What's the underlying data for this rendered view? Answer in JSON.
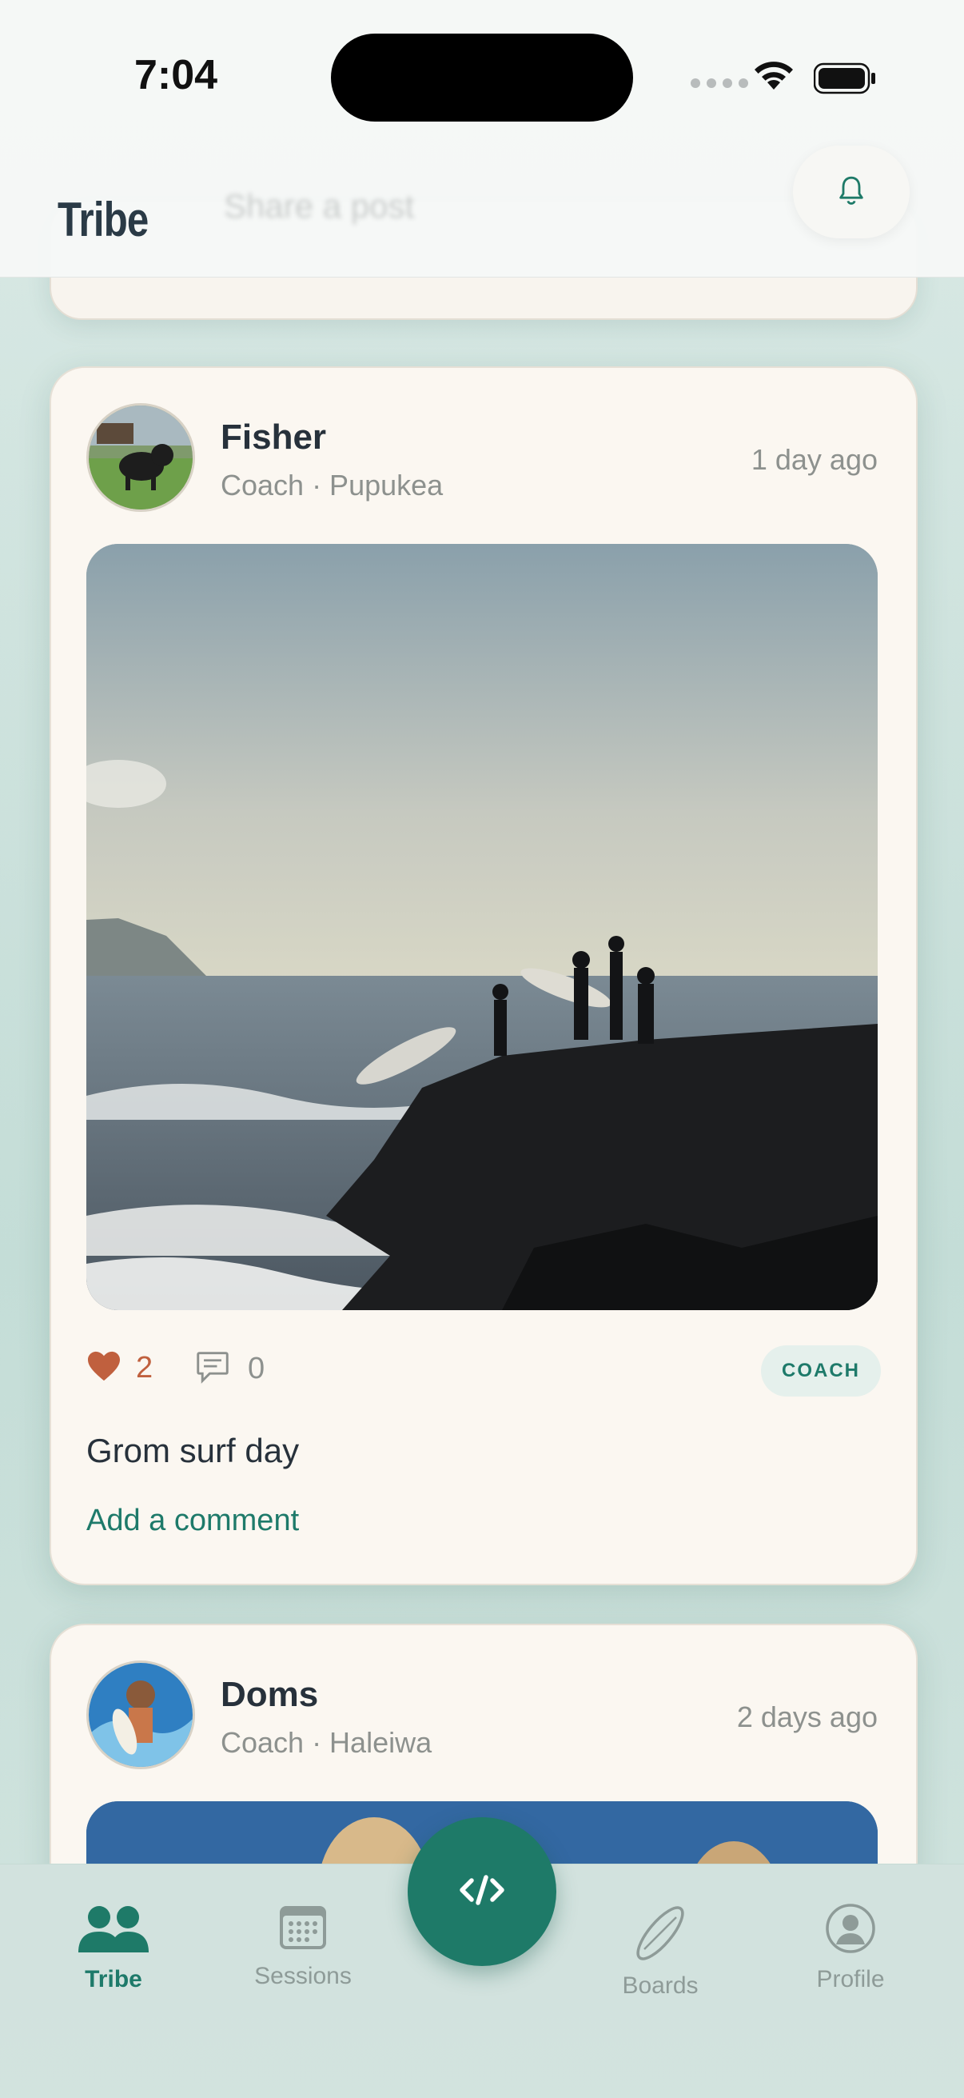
{
  "status_bar": {
    "time": "7:04"
  },
  "header": {
    "title": "Tribe",
    "share_placeholder": "Share a post"
  },
  "posts": [
    {
      "author": "Fisher",
      "meta": "Coach · Pupukea",
      "time": "1 day ago",
      "likes": "2",
      "comments": "0",
      "badge": "COACH",
      "caption": "Grom surf day",
      "add_comment": "Add a comment"
    },
    {
      "author": "Doms",
      "meta": "Coach · Haleiwa",
      "time": "2 days ago"
    }
  ],
  "nav": {
    "tribe": "Tribe",
    "sessions": "Sessions",
    "boards": "Boards",
    "profile": "Profile"
  },
  "colors": {
    "accent": "#1e7a68",
    "like": "#c0603e",
    "card": "#fbf7f1"
  }
}
